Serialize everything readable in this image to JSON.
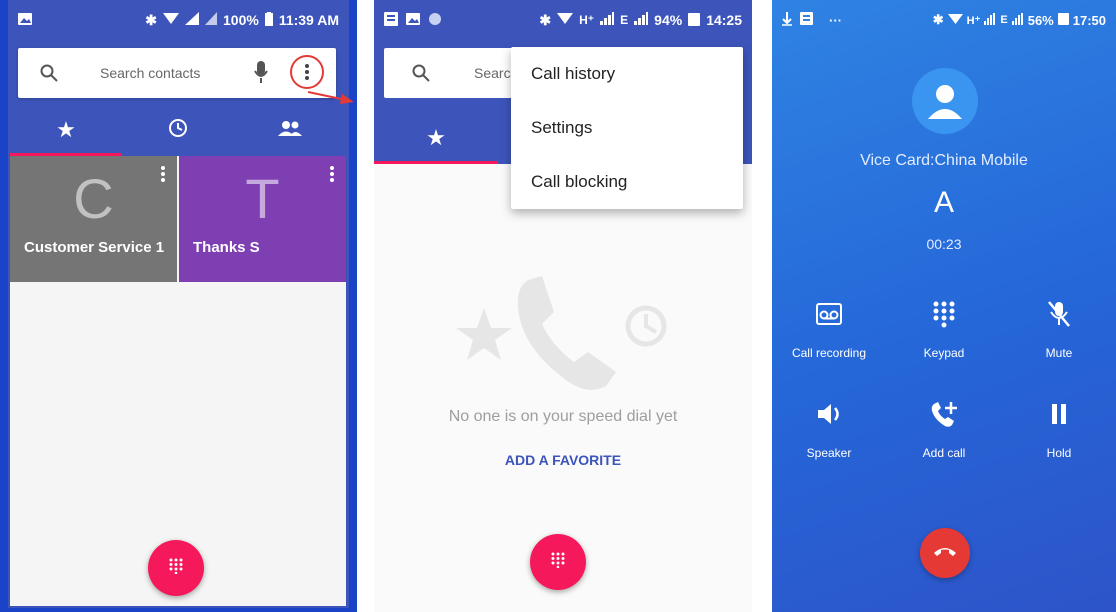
{
  "phone1": {
    "status": {
      "battery": "100%",
      "time": "11:39 AM"
    },
    "search_placeholder": "Search contacts",
    "contacts": [
      {
        "initial": "C",
        "name": "Customer Service 1",
        "color": "#757575"
      },
      {
        "initial": "T",
        "name": "Thanks S",
        "color": "#7e3fb3"
      }
    ],
    "highlight_color": "#e53935"
  },
  "phone2": {
    "status": {
      "network": "H⁺",
      "signal2": "E",
      "battery": "94%",
      "time": "14:25"
    },
    "search_placeholder_partial": "Searc",
    "menu": [
      "Call history",
      "Settings",
      "Call blocking"
    ],
    "empty_message": "No one is on your speed dial yet",
    "add_favorite": "ADD A FAVORITE"
  },
  "phone3": {
    "status": {
      "dots": "···",
      "network": "H⁺",
      "signal2": "E",
      "battery": "56%",
      "time": "17:50"
    },
    "carrier": "Vice Card:China Mobile",
    "caller": "A",
    "duration": "00:23",
    "actions": [
      "Call recording",
      "Keypad",
      "Mute",
      "Speaker",
      "Add call",
      "Hold"
    ]
  },
  "colors": {
    "primary": "#3d55bb",
    "accent": "#f5195b",
    "hangup": "#e53935"
  }
}
